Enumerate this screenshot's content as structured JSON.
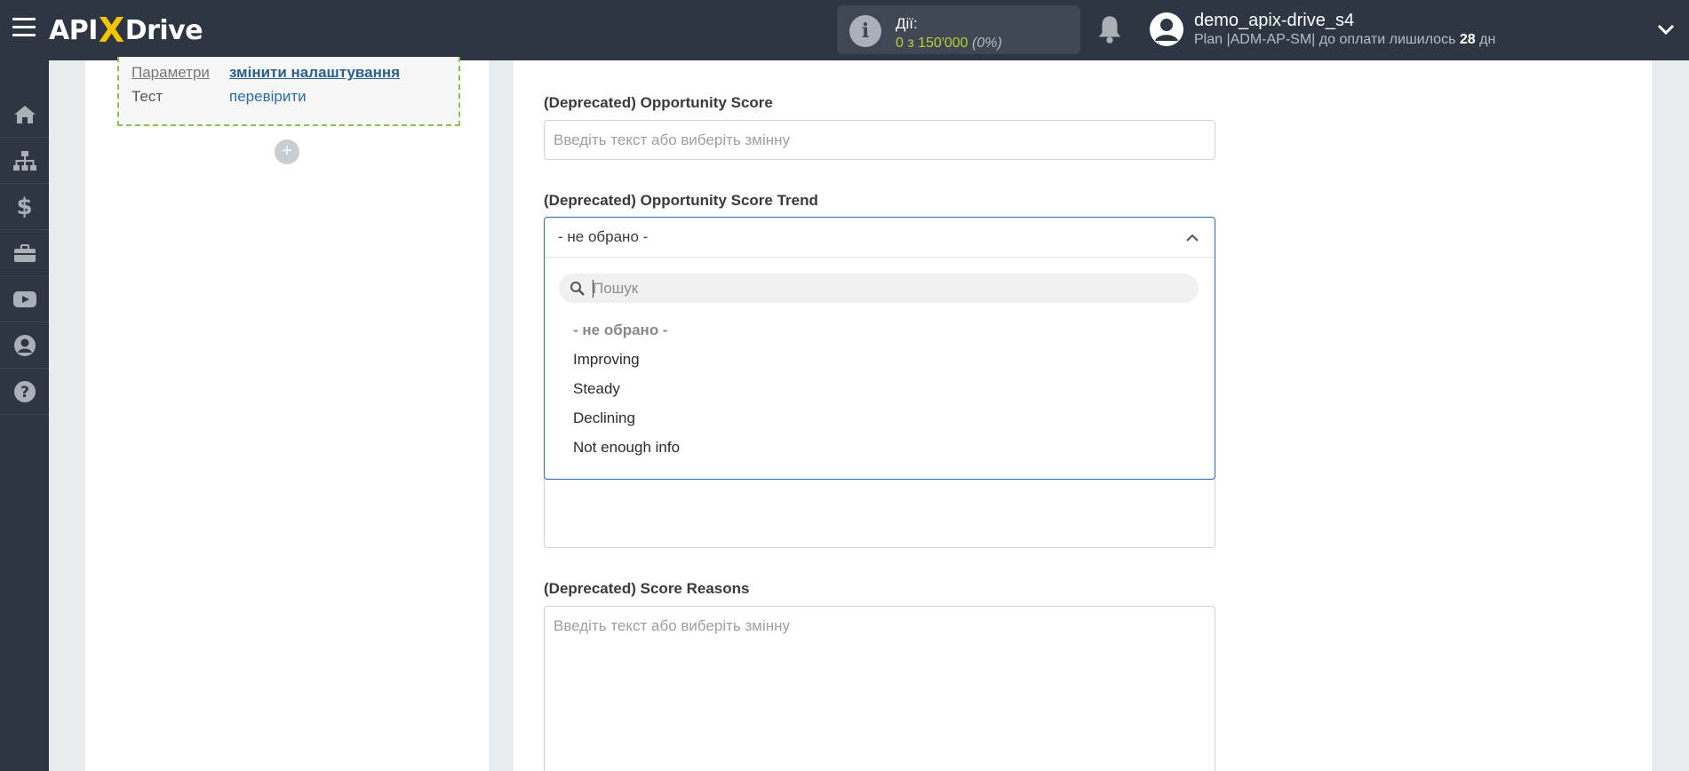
{
  "header": {
    "logo_text_left": "API",
    "logo_text_x": "X",
    "logo_text_right": "Drive",
    "actions_label": "Дії:",
    "actions_count": "0 з 150'000",
    "actions_percent": "(0%)",
    "user_name": "demo_apix-drive_s4",
    "plan_prefix": "Plan |ADM-AP-SM| до оплати лишилось ",
    "plan_days": "28",
    "plan_suffix": " дн"
  },
  "sidebar": {
    "items": [
      {
        "icon": "home-icon"
      },
      {
        "icon": "sitemap-icon"
      },
      {
        "icon": "dollar-icon"
      },
      {
        "icon": "briefcase-icon"
      },
      {
        "icon": "youtube-icon"
      },
      {
        "icon": "user-icon"
      },
      {
        "icon": "help-icon"
      }
    ]
  },
  "left_panel": {
    "rows": [
      {
        "key": "Параметри",
        "value": "змінити налаштування"
      },
      {
        "key": "Тест",
        "value": "перевірити"
      }
    ],
    "add_label": "+"
  },
  "form": {
    "opportunity_score_label": "(Deprecated) Opportunity Score",
    "opportunity_score_placeholder": "Введіть текст або виберіть змінну",
    "score_trend_label": "(Deprecated) Opportunity Score Trend",
    "score_trend_selected": "- не обрано -",
    "search_placeholder": "Пошук",
    "options": [
      "- не обрано -",
      "Improving",
      "Steady",
      "Declining",
      "Not enough info"
    ],
    "score_reasons_label": "(Deprecated) Score Reasons",
    "score_reasons_placeholder": "Введіть текст або виберіть змінну"
  },
  "colors": {
    "topbar": "#2d3642",
    "accent_yellow": "#f5c400",
    "actions_green": "#b5d334",
    "select_border": "#2a6bb0",
    "dashed_green": "#8cc152"
  }
}
